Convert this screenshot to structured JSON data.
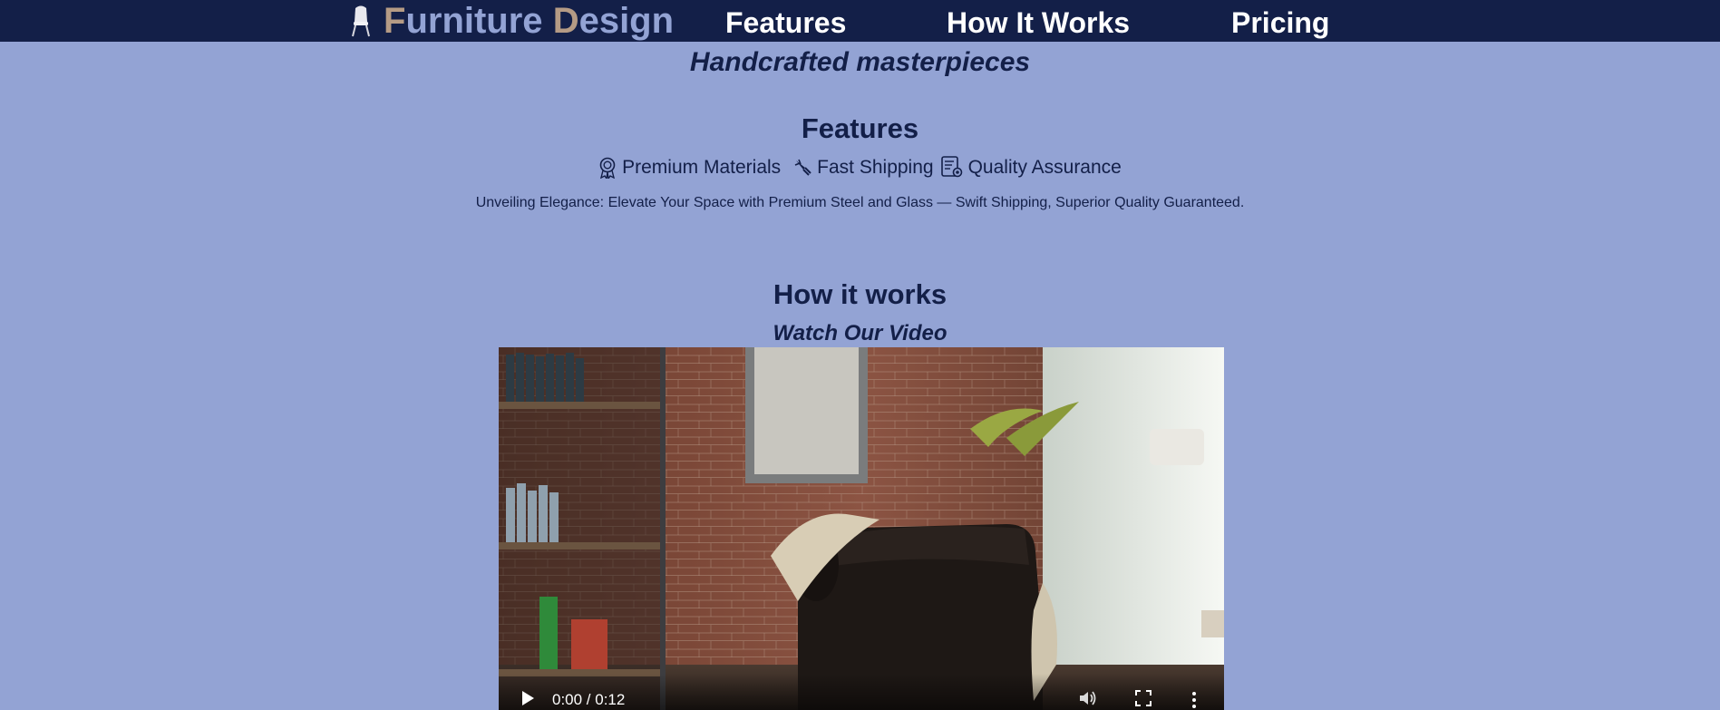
{
  "nav": {
    "logo": {
      "icon": "chair-icon",
      "word1_initial": "F",
      "word1_rest": "urniture",
      "word2_initial": "D",
      "word2_rest": "esign"
    },
    "links": [
      "Features",
      "How It Works",
      "Pricing"
    ]
  },
  "hero": {
    "tagline": "Handcrafted masterpieces"
  },
  "features": {
    "title": "Features",
    "items": [
      {
        "icon": "award-icon",
        "label": "Premium Materials"
      },
      {
        "icon": "rocket-icon",
        "label": "Fast Shipping"
      },
      {
        "icon": "certificate-icon",
        "label": "Quality Assurance"
      }
    ],
    "description": "Unveiling Elegance: Elevate Your Space with Premium Steel and Glass — Swift Shipping, Superior Quality Guaranteed."
  },
  "how_it_works": {
    "title": "How it works",
    "subtitle": "Watch Our Video",
    "video": {
      "time_display": "0:00 / 0:12",
      "controls": [
        "play-icon",
        "volume-icon",
        "fullscreen-icon",
        "more-options-icon"
      ]
    }
  },
  "colors": {
    "background": "#93a3d4",
    "navbar": "#131f48",
    "heading_text": "#131f48",
    "logo_initial": "#b59b85",
    "logo_text": "#93a3d4",
    "nav_link": "#ffffff"
  }
}
